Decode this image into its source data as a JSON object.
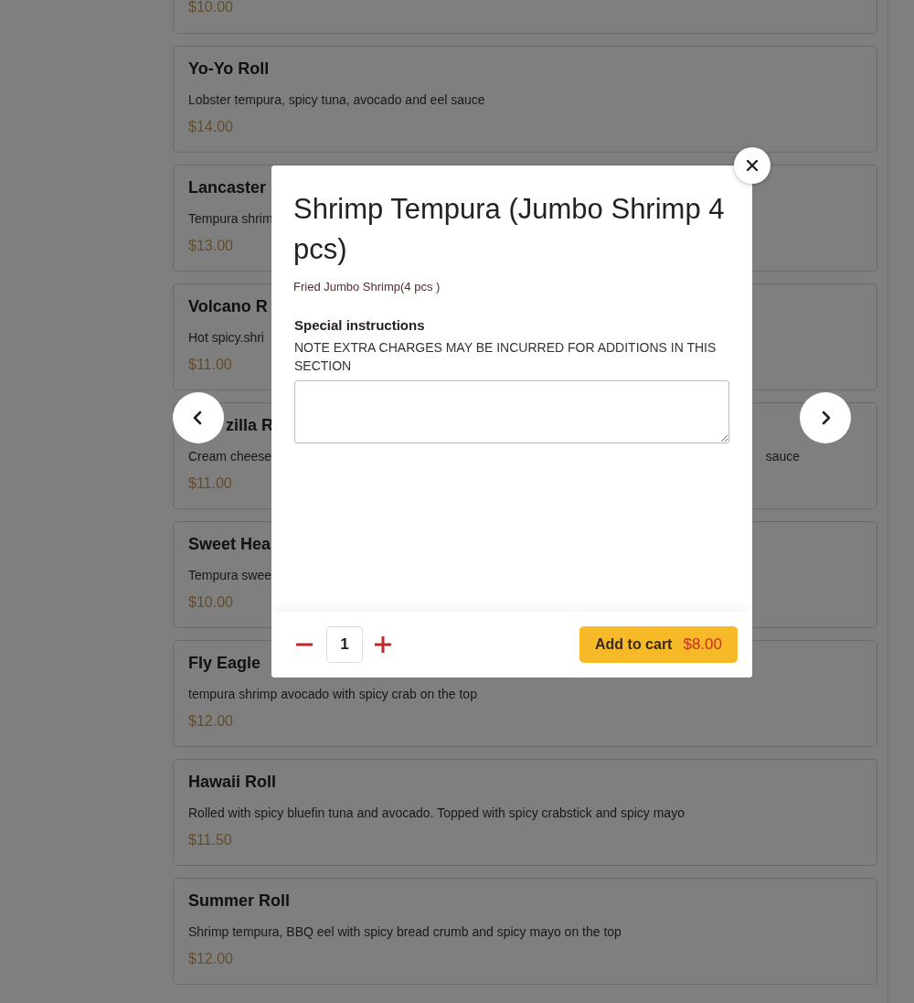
{
  "menu_items": [
    {
      "price": "$10.00"
    },
    {
      "name": "Yo-Yo Roll",
      "description": "Lobster tempura, spicy tuna, avocado and eel sauce",
      "price": "$14.00"
    },
    {
      "name": "Lancaster",
      "description": "Tempura shrim",
      "price": "$13.00"
    },
    {
      "name": "Volcano R",
      "description": "Hot spicy.shri",
      "price": "$11.00"
    },
    {
      "name": "zilla R",
      "cut_left": true,
      "description": "Cream cheese",
      "description_right": "sauce",
      "price": "$11.00"
    },
    {
      "name": "Sweet Hea",
      "description": "Tempura swee",
      "price": "$10.00"
    },
    {
      "name": "Fly Eagle",
      "description": "tempura shrimp avocado with spicy crab on the top",
      "price": "$12.00"
    },
    {
      "name": "Hawaii Roll",
      "description": "Rolled with spicy bluefin tuna and avocado. Topped with spicy crabstick and spicy mayo",
      "price": "$11.50"
    },
    {
      "name": "Summer Roll",
      "description": "Shrimp tempura, BBQ eel with spicy bread crumb and spicy mayo on the top",
      "price": "$12.00"
    }
  ],
  "modal": {
    "title": "Shrimp Tempura (Jumbo Shrimp 4 pcs)",
    "subtitle": "Fried Jumbo Shrimp(4 pcs )",
    "instructions_label": "Special instructions",
    "instructions_note": "NOTE EXTRA CHARGES MAY BE INCURRED FOR ADDITIONS IN THIS SECTION",
    "quantity": "1",
    "add_button": {
      "label": "Add to cart",
      "price": "$8.00"
    }
  }
}
